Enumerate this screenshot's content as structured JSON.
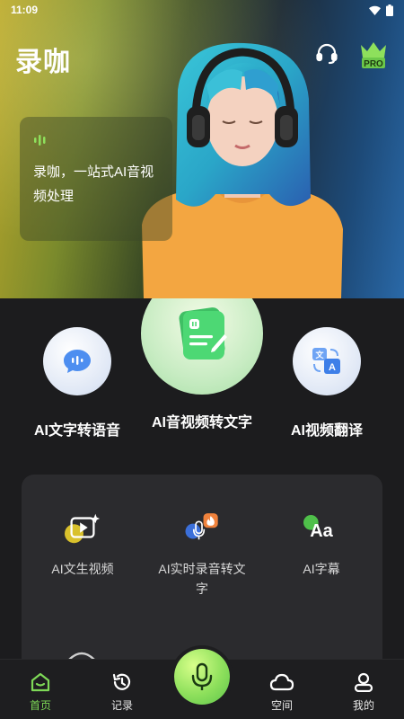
{
  "status_bar": {
    "time": "11:09",
    "icons": [
      "wifi-icon",
      "battery-icon"
    ]
  },
  "header": {
    "title": "录咖",
    "headset_icon": "headset-icon",
    "pro_badge": "PRO"
  },
  "hero": {
    "intro_text": "录咖，一站式AI音视频处理"
  },
  "features": [
    {
      "label": "AI文字转语音",
      "icon": "speech-bubble-icon"
    },
    {
      "label": "AI音视频转文字",
      "icon": "transcribe-icon"
    },
    {
      "label": "AI视频翻译",
      "icon": "translate-icon"
    }
  ],
  "tools": [
    {
      "label": "AI文生视频",
      "icon": "text-to-video-icon"
    },
    {
      "label": "AI实时录音转文字",
      "icon": "realtime-mic-icon",
      "badge": "fire-icon"
    },
    {
      "label": "AI字幕",
      "icon": "subtitle-icon",
      "glyph": "Aa"
    }
  ],
  "nav": {
    "home": "首页",
    "records": "记录",
    "space": "空间",
    "mine": "我的"
  },
  "colors": {
    "accent_green": "#7ed957",
    "panel_bg": "#2b2b2e",
    "page_bg": "#1c1c1e"
  }
}
